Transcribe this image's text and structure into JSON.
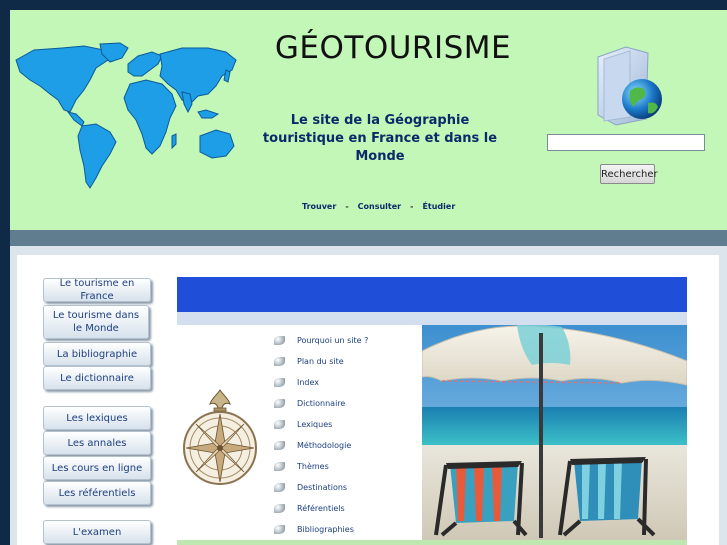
{
  "header": {
    "title": "GÉOTOURISME",
    "tagline": "Le site de la Géographie touristique en France et dans le Monde",
    "nav": [
      "Trouver",
      "Consulter",
      "Étudier"
    ],
    "nav_separator": "-"
  },
  "search": {
    "value": "",
    "button_label": "Rechercher"
  },
  "left_menu": {
    "items": [
      "Le tourisme en France",
      "Le tourisme dans le Monde",
      "La bibliographie",
      "Le dictionnaire",
      "Les lexiques",
      "Les annales",
      "Les cours en ligne",
      "Les référentiels",
      "L'examen"
    ]
  },
  "site_links": [
    "Pourquoi un site ?",
    "Plan du site",
    "Index",
    "Dictionnaire",
    "Lexiques",
    "Méthodologie",
    "Thèmes",
    "Destinations",
    "Référentiels",
    "Bibliographies"
  ],
  "icons": {
    "map": "world-map",
    "folder": "folder-globe-icon",
    "compass": "compass-rose",
    "bullet": "bullet-icon",
    "photo": "beach-umbrella-photo"
  },
  "colors": {
    "header_bg": "#c3f7b8",
    "banner_blue": "#1f4fd8",
    "link_blue": "#1c3f80",
    "page_bg": "#0e2a47"
  }
}
